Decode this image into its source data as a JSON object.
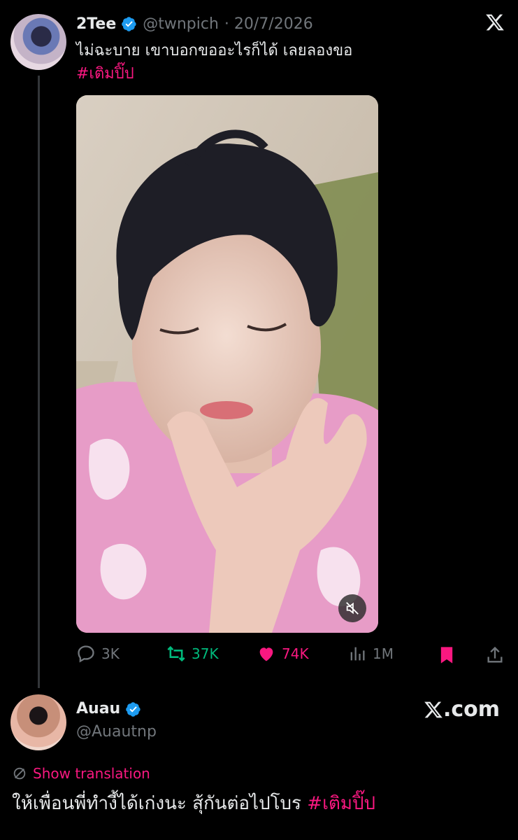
{
  "tweet1": {
    "author_name": "2Tee",
    "handle": "@twnpich",
    "date": "· 20/7/2026",
    "text": "ไม่ฉะบาย เขาบอกขออะไรก็ได้ เลยลองขอ",
    "hashtag": "#เติมปิ๊ป",
    "stats": {
      "replies": "3K",
      "reposts": "37K",
      "likes": "74K",
      "views": "1M"
    }
  },
  "tweet2": {
    "author_name": "Auau",
    "handle": "@Auautnp",
    "show_translation": "Show translation",
    "text": "ให้เพื่อนพี่ทำงี้ได้เก่งนะ สุ้กันต่อไปโบร ",
    "hashtag": "#เติมปิ๊ป"
  },
  "brand": {
    "logo_text": "X",
    "site": ".com"
  },
  "colors": {
    "background": "#000000",
    "text": "#e7e9ea",
    "muted": "#71767b",
    "pink": "#f91880",
    "green": "#00ba7c",
    "blue_verified": "#1d9bf0"
  },
  "icons": [
    "x-logo-icon",
    "verified-icon",
    "reply-icon",
    "repost-icon",
    "like-icon",
    "views-icon",
    "bookmark-icon",
    "share-icon",
    "mute-icon",
    "translate-icon"
  ]
}
